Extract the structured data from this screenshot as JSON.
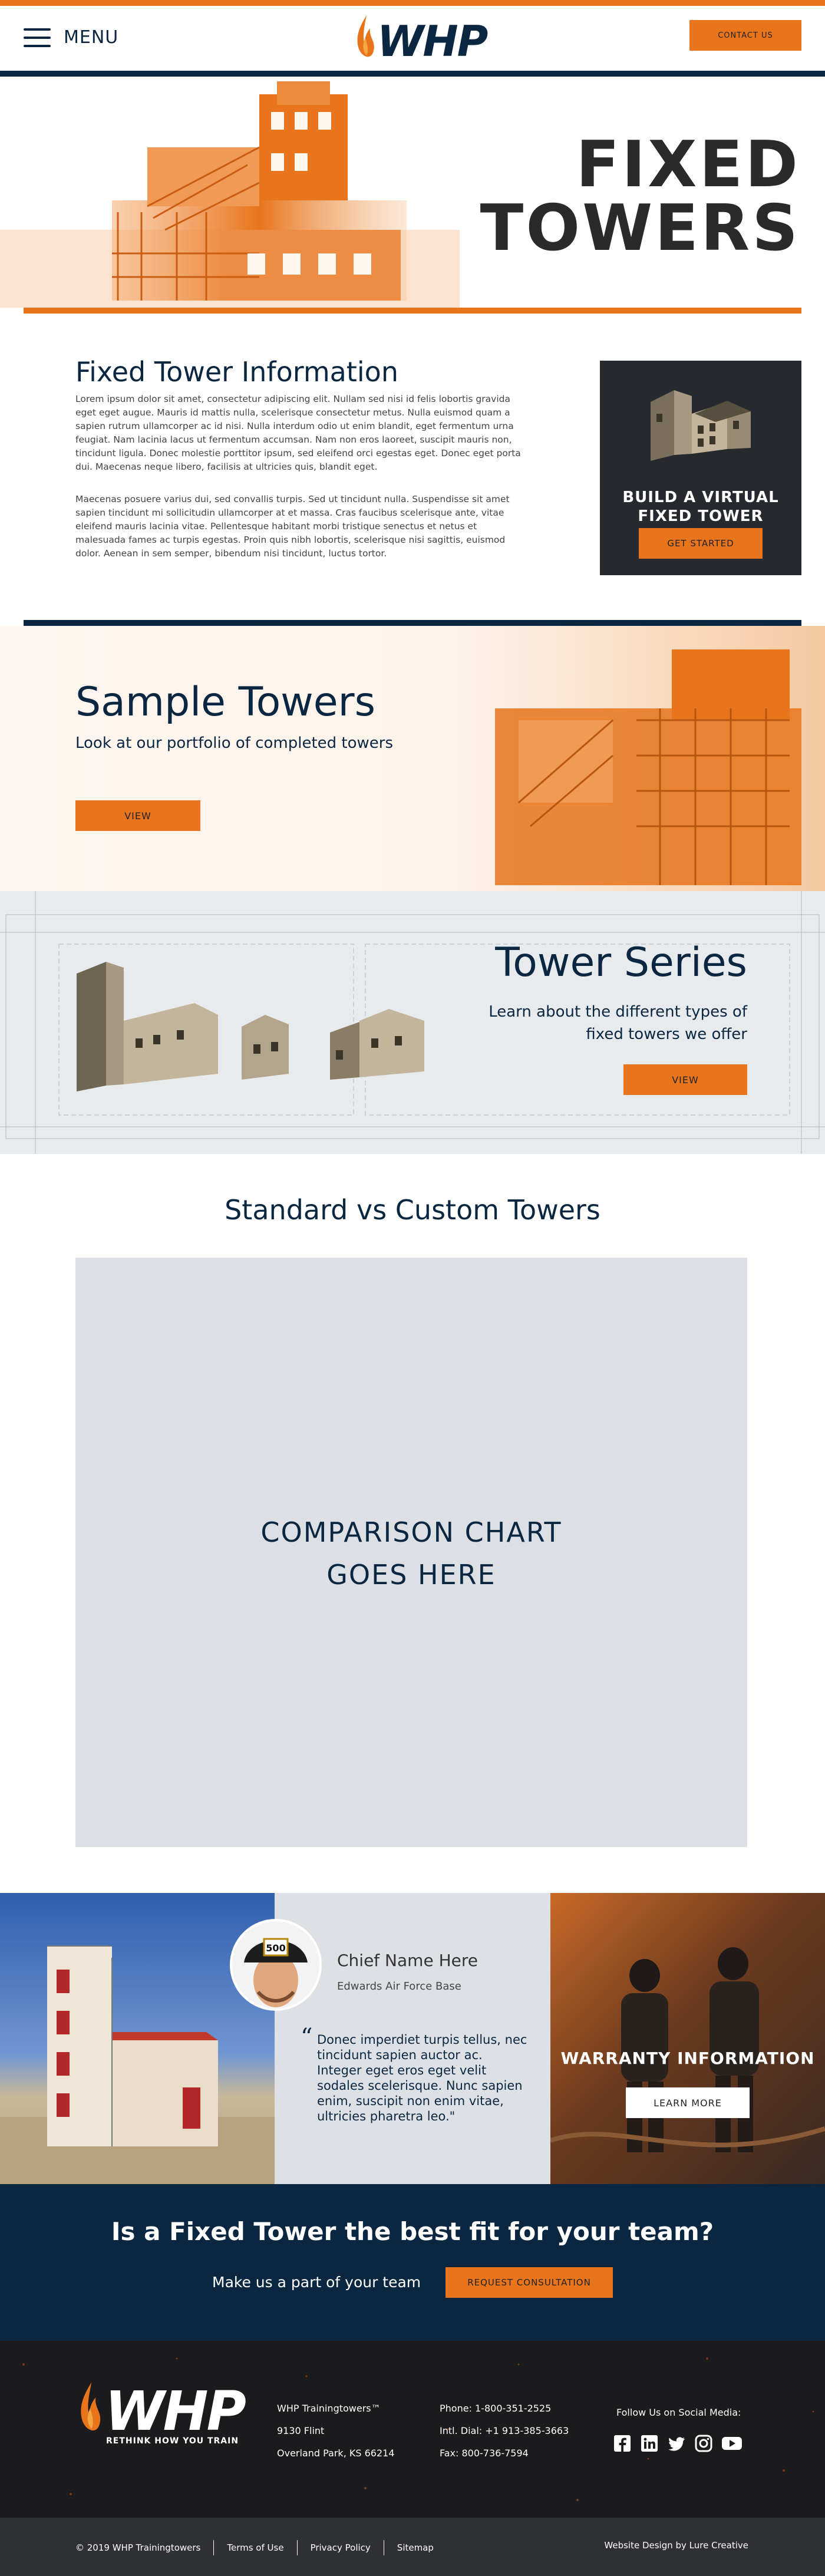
{
  "header": {
    "menu_label": "MENU",
    "logo_text": "WHP",
    "contact_label": "CONTACT US"
  },
  "hero": {
    "title_line1": "FIXED",
    "title_line2": "TOWERS"
  },
  "info": {
    "heading": "Fixed Tower Information",
    "paragraph1": "Lorem ipsum dolor sit amet, consectetur adipiscing elit. Nullam sed nisi id felis lobortis gravida eget eget augue. Mauris id mattis nulla, scelerisque consectetur metus. Nulla euismod quam a sapien rutrum ullamcorper ac id nisi. Nulla interdum odio ut enim blandit, eget fermentum urna feugiat. Nam lacinia lacus ut fermentum accumsan. Nam non eros laoreet, suscipit mauris non, tincidunt ligula. Donec molestie porttitor ipsum, sed eleifend orci egestas eget. Donec eget porta dui. Maecenas neque libero, facilisis at ultricies quis, blandit eget.",
    "paragraph2": "Maecenas posuere varius dui, sed convallis turpis. Sed ut tincidunt nulla. Suspendisse sit amet sapien tincidunt mi sollicitudin ullamcorper at et massa. Cras faucibus scelerisque ante, vitae eleifend mauris lacinia vitae. Pellentesque habitant morbi tristique senectus et netus et malesuada fames ac turpis egestas. Proin quis nibh lobortis, scelerisque nisi sagittis, euismod dolor. Aenean in sem semper, bibendum nisi tincidunt, luctus tortor.",
    "card_title_line1": "BUILD A VIRTUAL",
    "card_title_line2": "FIXED TOWER",
    "card_button": "GET STARTED"
  },
  "sample": {
    "heading": "Sample Towers",
    "subtitle": "Look at our portfolio of completed towers",
    "button": "VIEW"
  },
  "series": {
    "heading": "Tower Series",
    "subtitle": "Learn about the different types of fixed towers we offer",
    "button": "VIEW"
  },
  "compare": {
    "heading": "Standard vs Custom Towers",
    "placeholder_line1": "COMPARISON CHART",
    "placeholder_line2": "GOES HERE"
  },
  "testimonial": {
    "name": "Chief Name Here",
    "base": "Edwards Air Force Base",
    "quote": "Donec imperdiet turpis tellus, nec tincidunt sapien auctor ac. Integer eget eros eget velit sodales scelerisque. Nunc sapien enim, suscipit non enim vitae, ultricies pharetra leo.\"",
    "helmet_number": "500"
  },
  "warranty": {
    "title": "WARRANTY INFORMATION",
    "button": "LEARN MORE"
  },
  "cta": {
    "heading": "Is a Fixed Tower the best fit for your team?",
    "subtitle": "Make us a part of your team",
    "button": "REQUEST CONSULTATION"
  },
  "footer": {
    "logo_text": "WHP",
    "tagline": "RETHINK HOW YOU TRAIN",
    "company": "WHP Trainingtowers™",
    "address1": "9130 Flint",
    "address2": "Overland Park, KS 66214",
    "phone": "Phone: 1-800-351-2525",
    "intl": "Intl. Dial: +1 913-385-3663",
    "fax": "Fax: 800-736-7594",
    "social_label": "Follow Us on Social Media:",
    "social_icons": [
      "facebook-icon",
      "linkedin-icon",
      "twitter-icon",
      "instagram-icon",
      "youtube-icon"
    ],
    "copyright": "© 2019 WHP Trainingtowers",
    "terms": "Terms of Use",
    "privacy": "Privacy Policy",
    "sitemap": "Sitemap",
    "credit": "Website Design by Lure Creative"
  },
  "colors": {
    "brand_orange": "#e8741c",
    "brand_navy": "#0b2640",
    "footer_dark": "#1b1b1d"
  }
}
